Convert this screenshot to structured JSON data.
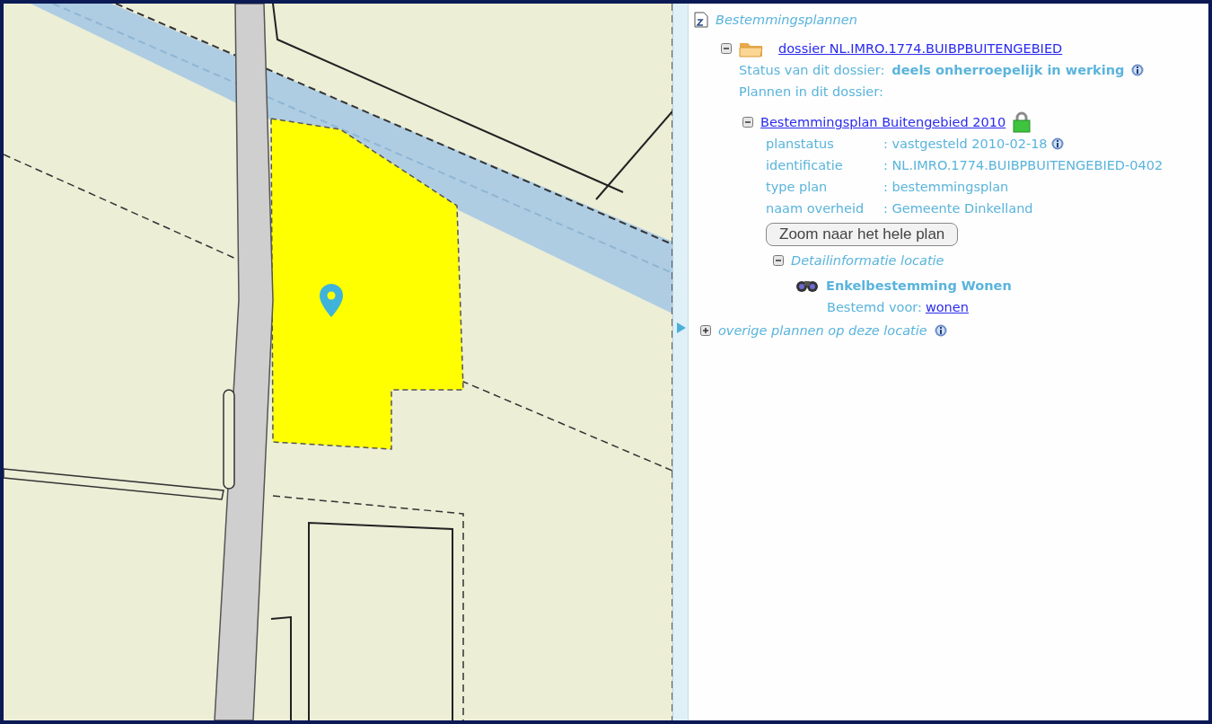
{
  "panel": {
    "title": "Bestemmingsplannen",
    "dossier": {
      "link": "dossier NL.IMRO.1774.BUIBPBUITENGEBIED",
      "expanded": true,
      "status_label": "Status van dit dossier:",
      "status_value": "deels onherroepelijk in werking",
      "status_info": true,
      "plans_label": "Plannen in dit dossier:",
      "plans": [
        {
          "link": "Bestemmingsplan Buitengebied 2010",
          "expanded": true,
          "properties": [
            {
              "label": "planstatus",
              "value": ": vastgesteld 2010-02-18",
              "info": true
            },
            {
              "label": "identificatie",
              "value": ": NL.IMRO.1774.BUIBPBUITENGEBIED-0402",
              "info": false
            },
            {
              "label": "type plan",
              "value": ": bestemmingsplan",
              "info": false
            },
            {
              "label": "naam overheid",
              "value": ": Gemeente Dinkelland",
              "info": false
            }
          ],
          "zoom_button": "Zoom naar het hele plan",
          "detail": {
            "title": "Detailinformatie locatie",
            "expanded": true,
            "name": "Enkelbestemming Wonen",
            "purpose_label": "Bestemd voor:",
            "purpose_link": "wonen"
          }
        }
      ]
    },
    "other": {
      "title": "overige plannen op deze locatie",
      "expanded": false,
      "info": true
    }
  }
}
